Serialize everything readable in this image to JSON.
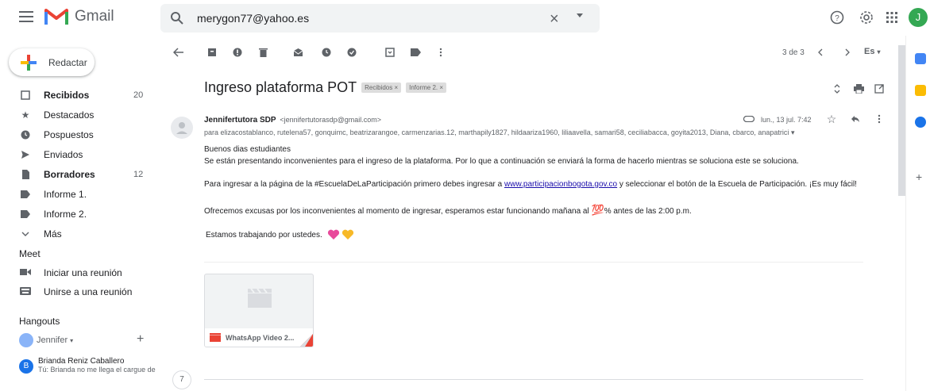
{
  "app": {
    "name": "Gmail"
  },
  "search": {
    "value": "merygon77@yahoo.es",
    "clear": "×"
  },
  "user": {
    "initial": "J"
  },
  "sidebar": {
    "compose_label": "Redactar",
    "items": [
      {
        "label": "Recibidos",
        "count": "20",
        "bold": true,
        "icon": "inbox-icon"
      },
      {
        "label": "Destacados",
        "count": "",
        "bold": false,
        "icon": "star-icon"
      },
      {
        "label": "Pospuestos",
        "count": "",
        "bold": false,
        "icon": "clock-icon"
      },
      {
        "label": "Enviados",
        "count": "",
        "bold": false,
        "icon": "send-icon"
      },
      {
        "label": "Borradores",
        "count": "12",
        "bold": true,
        "icon": "draft-icon"
      },
      {
        "label": "Informe 1.",
        "count": "",
        "bold": false,
        "icon": "label-icon"
      },
      {
        "label": "Informe 2.",
        "count": "",
        "bold": false,
        "icon": "label-icon"
      },
      {
        "label": "Más",
        "count": "",
        "bold": false,
        "icon": "chevron-down-icon"
      }
    ],
    "meet": {
      "title": "Meet",
      "start": "Iniciar una reunión",
      "join": "Unirse a una reunión"
    },
    "hangouts": {
      "title": "Hangouts",
      "user": "Jennifer",
      "contact_initial": "B",
      "contact_name": "Brianda Reniz Caballero",
      "contact_snippet": "Tú: Brianda no me llega el cargue de"
    }
  },
  "toolbar": {
    "pager": "3 de 3",
    "lang": "Es"
  },
  "email": {
    "subject": "Ingreso plataforma POT",
    "labels": [
      "Recibidos ×",
      "Informe 2. ×"
    ],
    "sender_name": "Jennifertutora SDP",
    "sender_email": "<jennifertutorasdp@gmail.com>",
    "date": "lun., 13 jul. 7:42",
    "recipients": "para elizacostablanco, rutelena57, gonquimc, beatrizarangoe, carmenzarias.12, marthapily1827, hildaariza1960, liliaavella, samari58, ceciliabacca, goyita2013, Diana, cbarco, anapatrici",
    "body": {
      "greeting": "Buenos dias estudiantes",
      "line1": "Se están presentando inconvenientes para el ingreso de la plataforma. Por lo que a continuación se enviará la forma de hacerlo mientras se soluciona este se soluciona.",
      "line2_pre": "Para ingresar a la página de la #EscuelaDeLaParticipación primero debes ingresar a ",
      "line2_link": "www.participacionbogota.gov.co",
      "line2_post": " y seleccionar el botón de la Escuela de Participación. ¡Es muy fácil!",
      "line3_pre": "Ofrecemos excusas por los inconvenientes al momento de ingresar, esperamos estar funcionando mañana al ",
      "line3_emoji": "💯",
      "line3_post": "% antes de las 2:00 p.m.",
      "line4": "Estamos trabajando por ustedes."
    },
    "attachment_name": "WhatsApp Video 2...",
    "thread_count": "7"
  },
  "colors": {
    "gmail_red": "#ea4335",
    "compose_plus_red": "#ea4335",
    "compose_plus_blue": "#4285f4",
    "compose_plus_yellow": "#fbbc04",
    "compose_plus_green": "#34a853",
    "avatar_green": "#34a853",
    "heart_pink": "#e84a9b",
    "heart_yellow": "#f7b928"
  }
}
